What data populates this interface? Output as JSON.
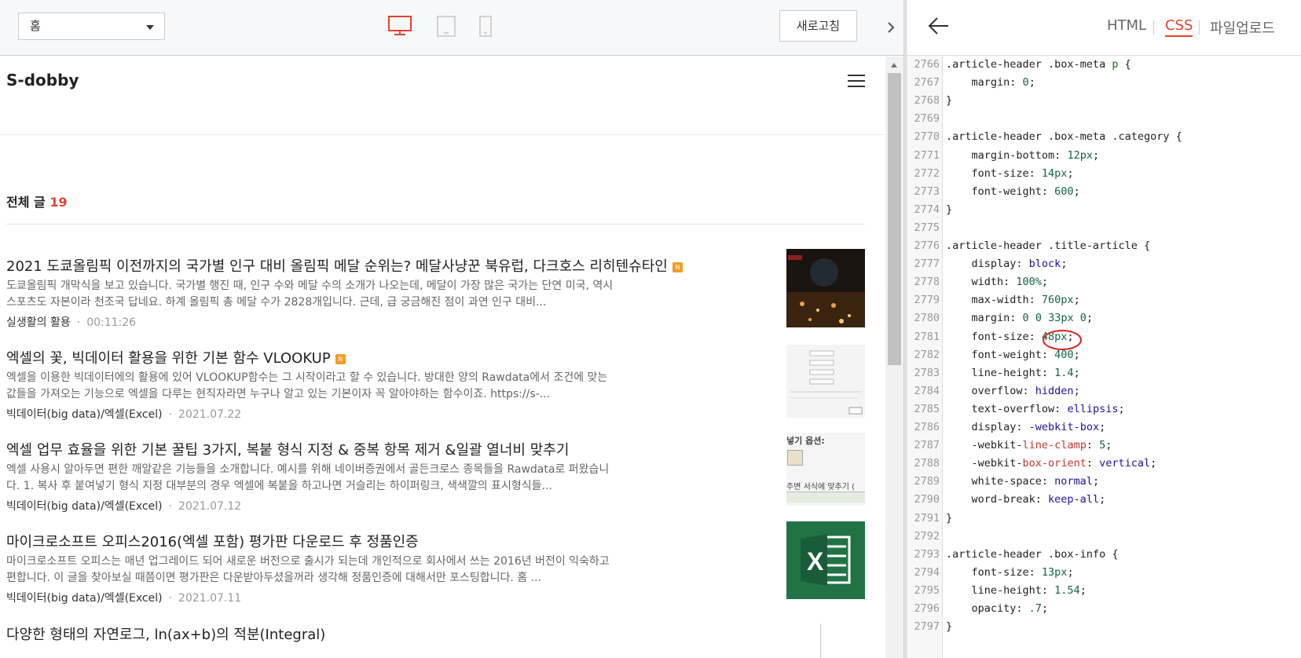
{
  "toolbar": {
    "page_select_value": "홈",
    "refresh_label": "새로고침",
    "devices": [
      "desktop-icon",
      "tablet-icon",
      "mobile-icon"
    ],
    "active_device": "desktop",
    "accent": "#e0432e"
  },
  "blog": {
    "title": "S-dobby",
    "total_label": "전체 글",
    "total_count": "19",
    "posts": [
      {
        "title": "2021 도쿄올림픽 이전까지의 국가별 인구 대비 올림픽 메달 순위는? 메달사냥꾼 북유럽, 다크호스 리히텐슈타인",
        "badge": "N",
        "summary": "도쿄올림픽 개막식을 보고 있습니다. 국가별 행진 때, 인구 수와 메달 수의 소개가 나오는데, 메달이 가장 많은 국가는 단연 미국, 역시 스포츠도 자본이라 천조국 답네요. 하계 올림픽 총 메달 수가 2828개입니다. 근데, 급 궁금해진 점이 과연 인구 대비...",
        "category": "실생활의 활용",
        "date": "00:11:26"
      },
      {
        "title": "엑셀의 꽃, 빅데이터 활용을 위한 기본 함수 VLOOKUP",
        "badge": "N",
        "summary": "엑셀을 이용한 빅데이터에의 활용에 있어 VLOOKUP함수는 그 시작이라고 할 수 있습니다. 방대한 양의 Rawdata에서 조건에 맞는 값들을 가져오는 기능으로 엑셀을 다루는 현직자라면 누구나 알고 있는 기본이자 꼭 알아야하는 함수이죠. https://s-...",
        "category": "빅데이터(big data)/엑셀(Excel)",
        "date": "2021.07.22"
      },
      {
        "title": "엑셀 업무 효율을 위한 기본 꿀팁 3가지, 복붙 형식 지정 & 중복 항목 제거 &일괄 열너비 맞추기",
        "badge": "",
        "summary": "엑셀 사용시 알아두면 편한 깨알같은 기능들을 소개합니다. 예시를 위해 네이버증권에서 골든크로스 종목들을 Rawdata로 퍼왔습니다. 1. 복사 후 붙여넣기 형식 지정 대부분의 경우 엑셀에 복붙을 하고나면 거슬리는 하이퍼링크, 색색깔의 표시형식들...",
        "category": "빅데이터(big data)/엑셀(Excel)",
        "date": "2021.07.12",
        "thumb_text_1": "넣기 옵션:",
        "thumb_text_2": "주변 서식에 맞추기 ("
      },
      {
        "title": "마이크로소프트 오피스2016(엑셀 포함) 평가판 다운로드 후 정품인증",
        "badge": "",
        "summary": "마이크로소프트 오피스는 매년 업그레이드 되어 새로운 버전으로 출시가 되는데 개인적으로 회사에서 쓰는 2016년 버전이 익숙하고 편합니다. 이 글을 찾아보실 때쯤이면 평가판은 다운받아두셨을꺼라 생각해 정품인증에 대해서만 포스팅합니다. 홈 ...",
        "category": "빅데이터(big data)/엑셀(Excel)",
        "date": "2021.07.11"
      },
      {
        "title": "다양한 형태의 자연로그, ln(ax+b)의 적분(Integral)",
        "badge": "",
        "summary": "",
        "category": "",
        "date": ""
      }
    ]
  },
  "editor": {
    "tabs": [
      "HTML",
      "CSS",
      "파일업로드"
    ],
    "active_tab": "CSS",
    "lines": [
      {
        "n": "2766",
        "t": ".article-header .box-meta p {"
      },
      {
        "n": "2767",
        "t": "    margin: 0;"
      },
      {
        "n": "2768",
        "t": "}"
      },
      {
        "n": "2769",
        "t": ""
      },
      {
        "n": "2770",
        "t": ".article-header .box-meta .category {"
      },
      {
        "n": "2771",
        "t": "    margin-bottom: 12px;"
      },
      {
        "n": "2772",
        "t": "    font-size: 14px;"
      },
      {
        "n": "2773",
        "t": "    font-weight: 600;"
      },
      {
        "n": "2774",
        "t": "}"
      },
      {
        "n": "2775",
        "t": ""
      },
      {
        "n": "2776",
        "t": ".article-header .title-article {"
      },
      {
        "n": "2777",
        "t": "    display: block;"
      },
      {
        "n": "2778",
        "t": "    width: 100%;"
      },
      {
        "n": "2779",
        "t": "    max-width: 760px;"
      },
      {
        "n": "2780",
        "t": "    margin: 0 0 33px 0;"
      },
      {
        "n": "2781",
        "t": "    font-size: 48px;"
      },
      {
        "n": "2782",
        "t": "    font-weight: 400;"
      },
      {
        "n": "2783",
        "t": "    line-height: 1.4;"
      },
      {
        "n": "2784",
        "t": "    overflow: hidden;"
      },
      {
        "n": "2785",
        "t": "    text-overflow: ellipsis;"
      },
      {
        "n": "2786",
        "t": "    display: -webkit-box;"
      },
      {
        "n": "2787",
        "t": "    -webkit-line-clamp: 5;"
      },
      {
        "n": "2788",
        "t": "    -webkit-box-orient: vertical;"
      },
      {
        "n": "2789",
        "t": "    white-space: normal;"
      },
      {
        "n": "2790",
        "t": "    word-break: keep-all;"
      },
      {
        "n": "2791",
        "t": "}"
      },
      {
        "n": "2792",
        "t": ""
      },
      {
        "n": "2793",
        "t": ".article-header .box-info {"
      },
      {
        "n": "2794",
        "t": "    font-size: 13px;"
      },
      {
        "n": "2795",
        "t": "    line-height: 1.54;"
      },
      {
        "n": "2796",
        "t": "    opacity: .7;"
      },
      {
        "n": "2797",
        "t": "}"
      }
    ],
    "highlight_annotation": "48px"
  }
}
